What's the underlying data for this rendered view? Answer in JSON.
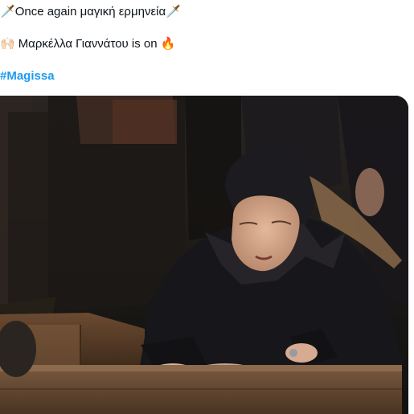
{
  "tweet": {
    "line1": {
      "emoji_left": "🗡️",
      "text": "Once again μαγική ερμηνεία",
      "emoji_right": "🗡️"
    },
    "line2": {
      "emoji_left": "🙌🏻",
      "text": "Μαρκέλλα Γιαννάτου is on",
      "emoji_right": "🔥"
    },
    "hashtag": "#Magissa"
  },
  "icons": {
    "line1_left": "sword-icon",
    "line1_right": "sword-icon",
    "line2_left": "raised-hands-icon",
    "line2_right": "fire-icon"
  },
  "colors": {
    "hashtag": "#1d9bf0",
    "text": "#0f1419",
    "background": "#ffffff"
  }
}
